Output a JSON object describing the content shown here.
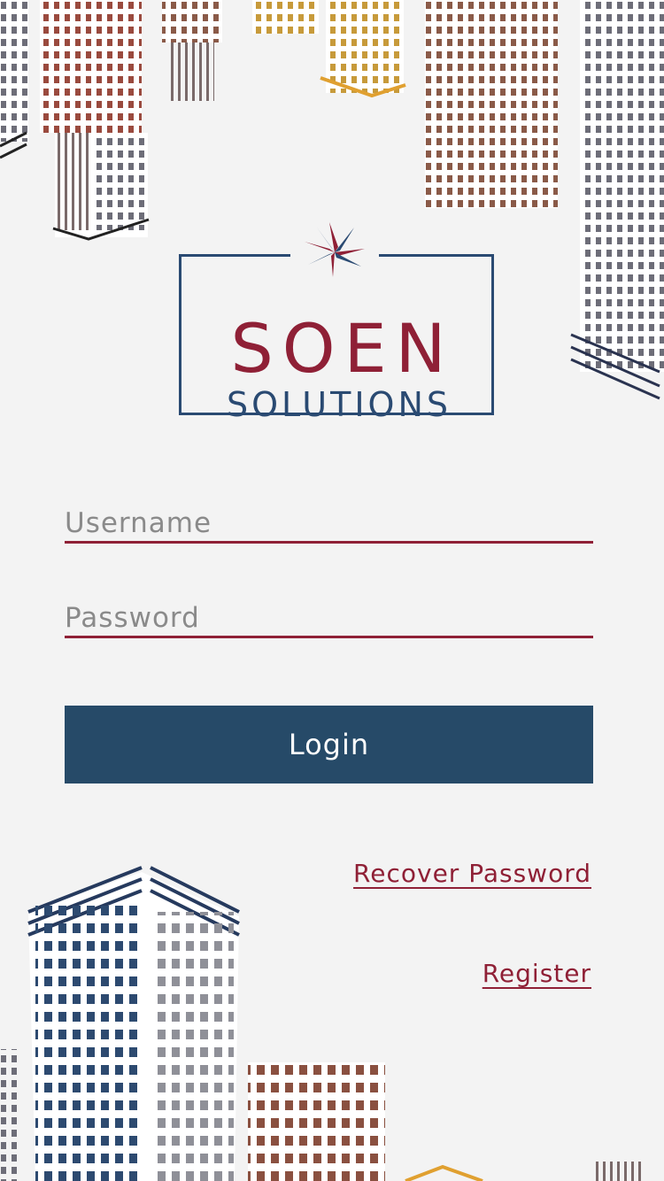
{
  "brand": {
    "line1": "SOEN",
    "line2": "SOLUTIONS",
    "primary_color": "#8f2036",
    "secondary_color": "#2a4a72"
  },
  "form": {
    "username_placeholder": "Username",
    "password_placeholder": "Password",
    "login_label": "Login",
    "button_color": "#264a68"
  },
  "links": {
    "recover_password": "Recover Password",
    "register": "Register"
  }
}
